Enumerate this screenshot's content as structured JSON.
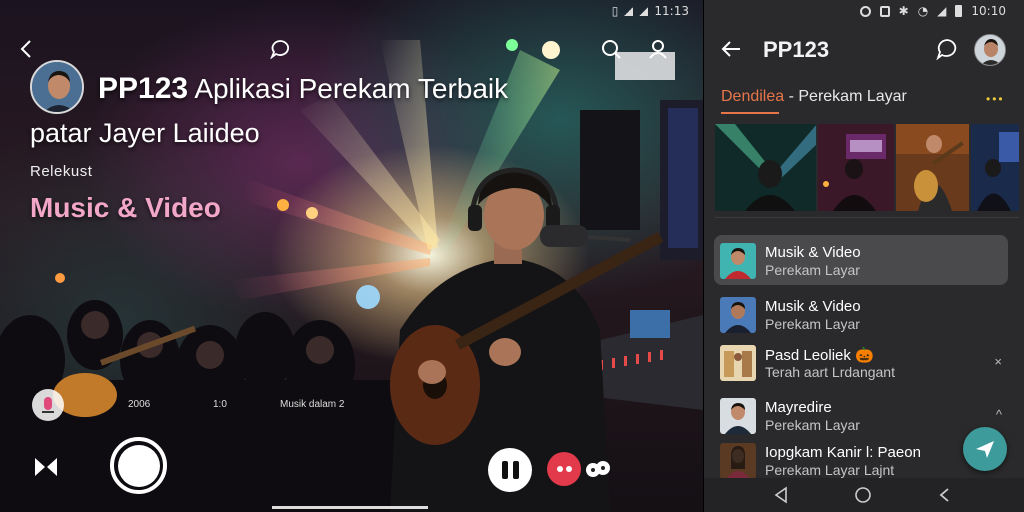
{
  "scene": {
    "status_time": "11:13",
    "title_bold": "PP123",
    "title_rest": "Aplikasi Perekam Terbaik",
    "subtitle": "patar Jayer Laiideo",
    "small_label": "Relekust",
    "category": "Music & Video",
    "overlay_texts": [
      "2006",
      "1:0",
      "Musik dalam 2"
    ],
    "icons": {
      "back": "chevron-left-icon",
      "chat": "chat-bubble-icon",
      "search": "search-icon",
      "account": "account-icon",
      "flip": "flip-camera-icon",
      "record": "record-icon",
      "pause": "pause-icon",
      "stop": "stop-icon",
      "camera": "camera-switch-icon"
    }
  },
  "panel": {
    "status_time": "10:10",
    "app_title": "PP123",
    "section_highlight": "Dendilea",
    "section_rest": " - Perekam Layar",
    "section_more": "•••",
    "items": [
      {
        "title": "Musik & Video",
        "subtitle": "Perekam Layar",
        "active": true,
        "mark": ""
      },
      {
        "title": "Musik & Video",
        "subtitle": "Perekam Layar",
        "active": false,
        "mark": ""
      },
      {
        "title": "Pasd Leoliek 🎃",
        "subtitle": "Terah aart Lrdangant",
        "active": false,
        "mark": "×"
      },
      {
        "title": "Mayredire",
        "subtitle": "Perekam Layar",
        "active": false,
        "mark": "^"
      },
      {
        "title": "Iopgkam Kanir l: Paeon",
        "subtitle": "Perekam Layar Lajnt",
        "active": false,
        "mark": ""
      }
    ],
    "accent_color": "#e5764a",
    "fab_color": "#3e9b9b"
  }
}
